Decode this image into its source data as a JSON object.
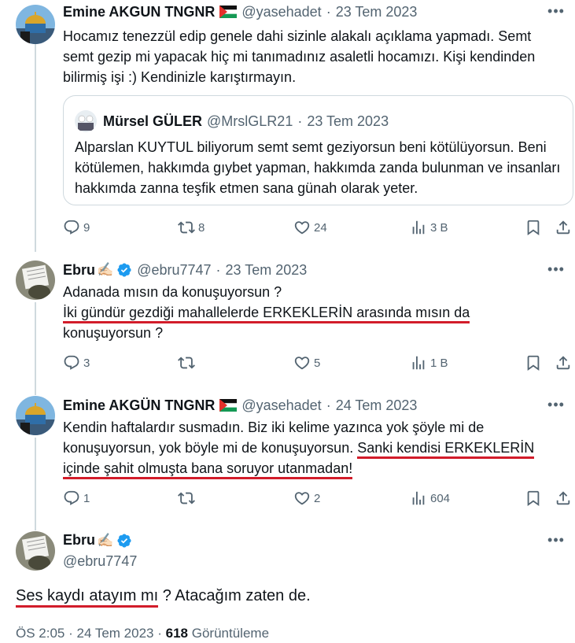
{
  "tweets": [
    {
      "author": "Emine AKGUN TNGNR",
      "handle": "@yasehadet",
      "separator": "·",
      "date": "23 Tem 2023",
      "text": "Hocamız tenezzül edip genele dahi sizinle alakalı açıklama yapmadı. Semt semt gezip mi yapacak hiç mi tanımadınız asaletli hocamızı. Kişi kendinden bilirmiş işi :) Kendinizle karıştırmayın.",
      "quote": {
        "author": "Mürsel GÜLER",
        "handle": "@MrslGLR21",
        "separator": "·",
        "date": "23 Tem 2023",
        "text": "Alparslan KUYTUL biliyorum semt semt geziyorsun beni kötülüyorsun. Beni kötülemen, hakkımda gıybet yapman, hakkımda zanda bulunman ve insanları hakkımda zanna teşfik etmen sana günah olarak yeter."
      },
      "replies": "9",
      "retweets": "8",
      "likes": "24",
      "views": "3 B"
    },
    {
      "author": "Ebru",
      "handle": "@ebru7747",
      "separator": "·",
      "date": "23 Tem 2023",
      "text_line1": "Adanada mısın da konuşuyorsun ?",
      "text_underlined": "İki gündür gezdiği mahallelerde ERKEKLERİN arasında mısın da",
      "text_line3": "konuşuyorsun ?",
      "replies": "3",
      "retweets": "",
      "likes": "5",
      "views": "1 B"
    },
    {
      "author": "Emine AKGÜN TNGNR",
      "handle": "@yasehadet",
      "separator": "·",
      "date": "24 Tem 2023",
      "text_plain": "Kendin haftalardır susmadın. Biz iki kelime yazınca yok şöyle mi de konuşuyorsun, yok böyle mi de konuşuyorsun. ",
      "text_underlined_1": "Sanki kendisi ERKEKLERİN",
      "text_underlined_2": "içinde şahit olmuşta bana soruyor utanmadan!",
      "replies": "1",
      "retweets": "",
      "likes": "2",
      "views": "604"
    }
  ],
  "main_tweet": {
    "author": "Ebru",
    "handle": "@ebru7747",
    "text_underlined": "Ses kaydı atayım mı",
    "text_rest": " ? Atacağım zaten de.",
    "time": "ÖS 2:05",
    "separator": "·",
    "date": "24 Tem 2023",
    "separator2": "·",
    "views_count": "618",
    "views_label": "Görüntüleme"
  },
  "emoji": {
    "writing_hand": "✍🏻"
  },
  "icons": [
    "more-icon",
    "reply-icon",
    "retweet-icon",
    "like-icon",
    "views-icon",
    "bookmark-icon",
    "share-icon",
    "verified-icon",
    "palestine-flag-icon"
  ],
  "colors": {
    "underline": "#d21c2a",
    "verified": "#1d9bf0",
    "muted": "#536471",
    "thread_line": "#cfd9de"
  }
}
